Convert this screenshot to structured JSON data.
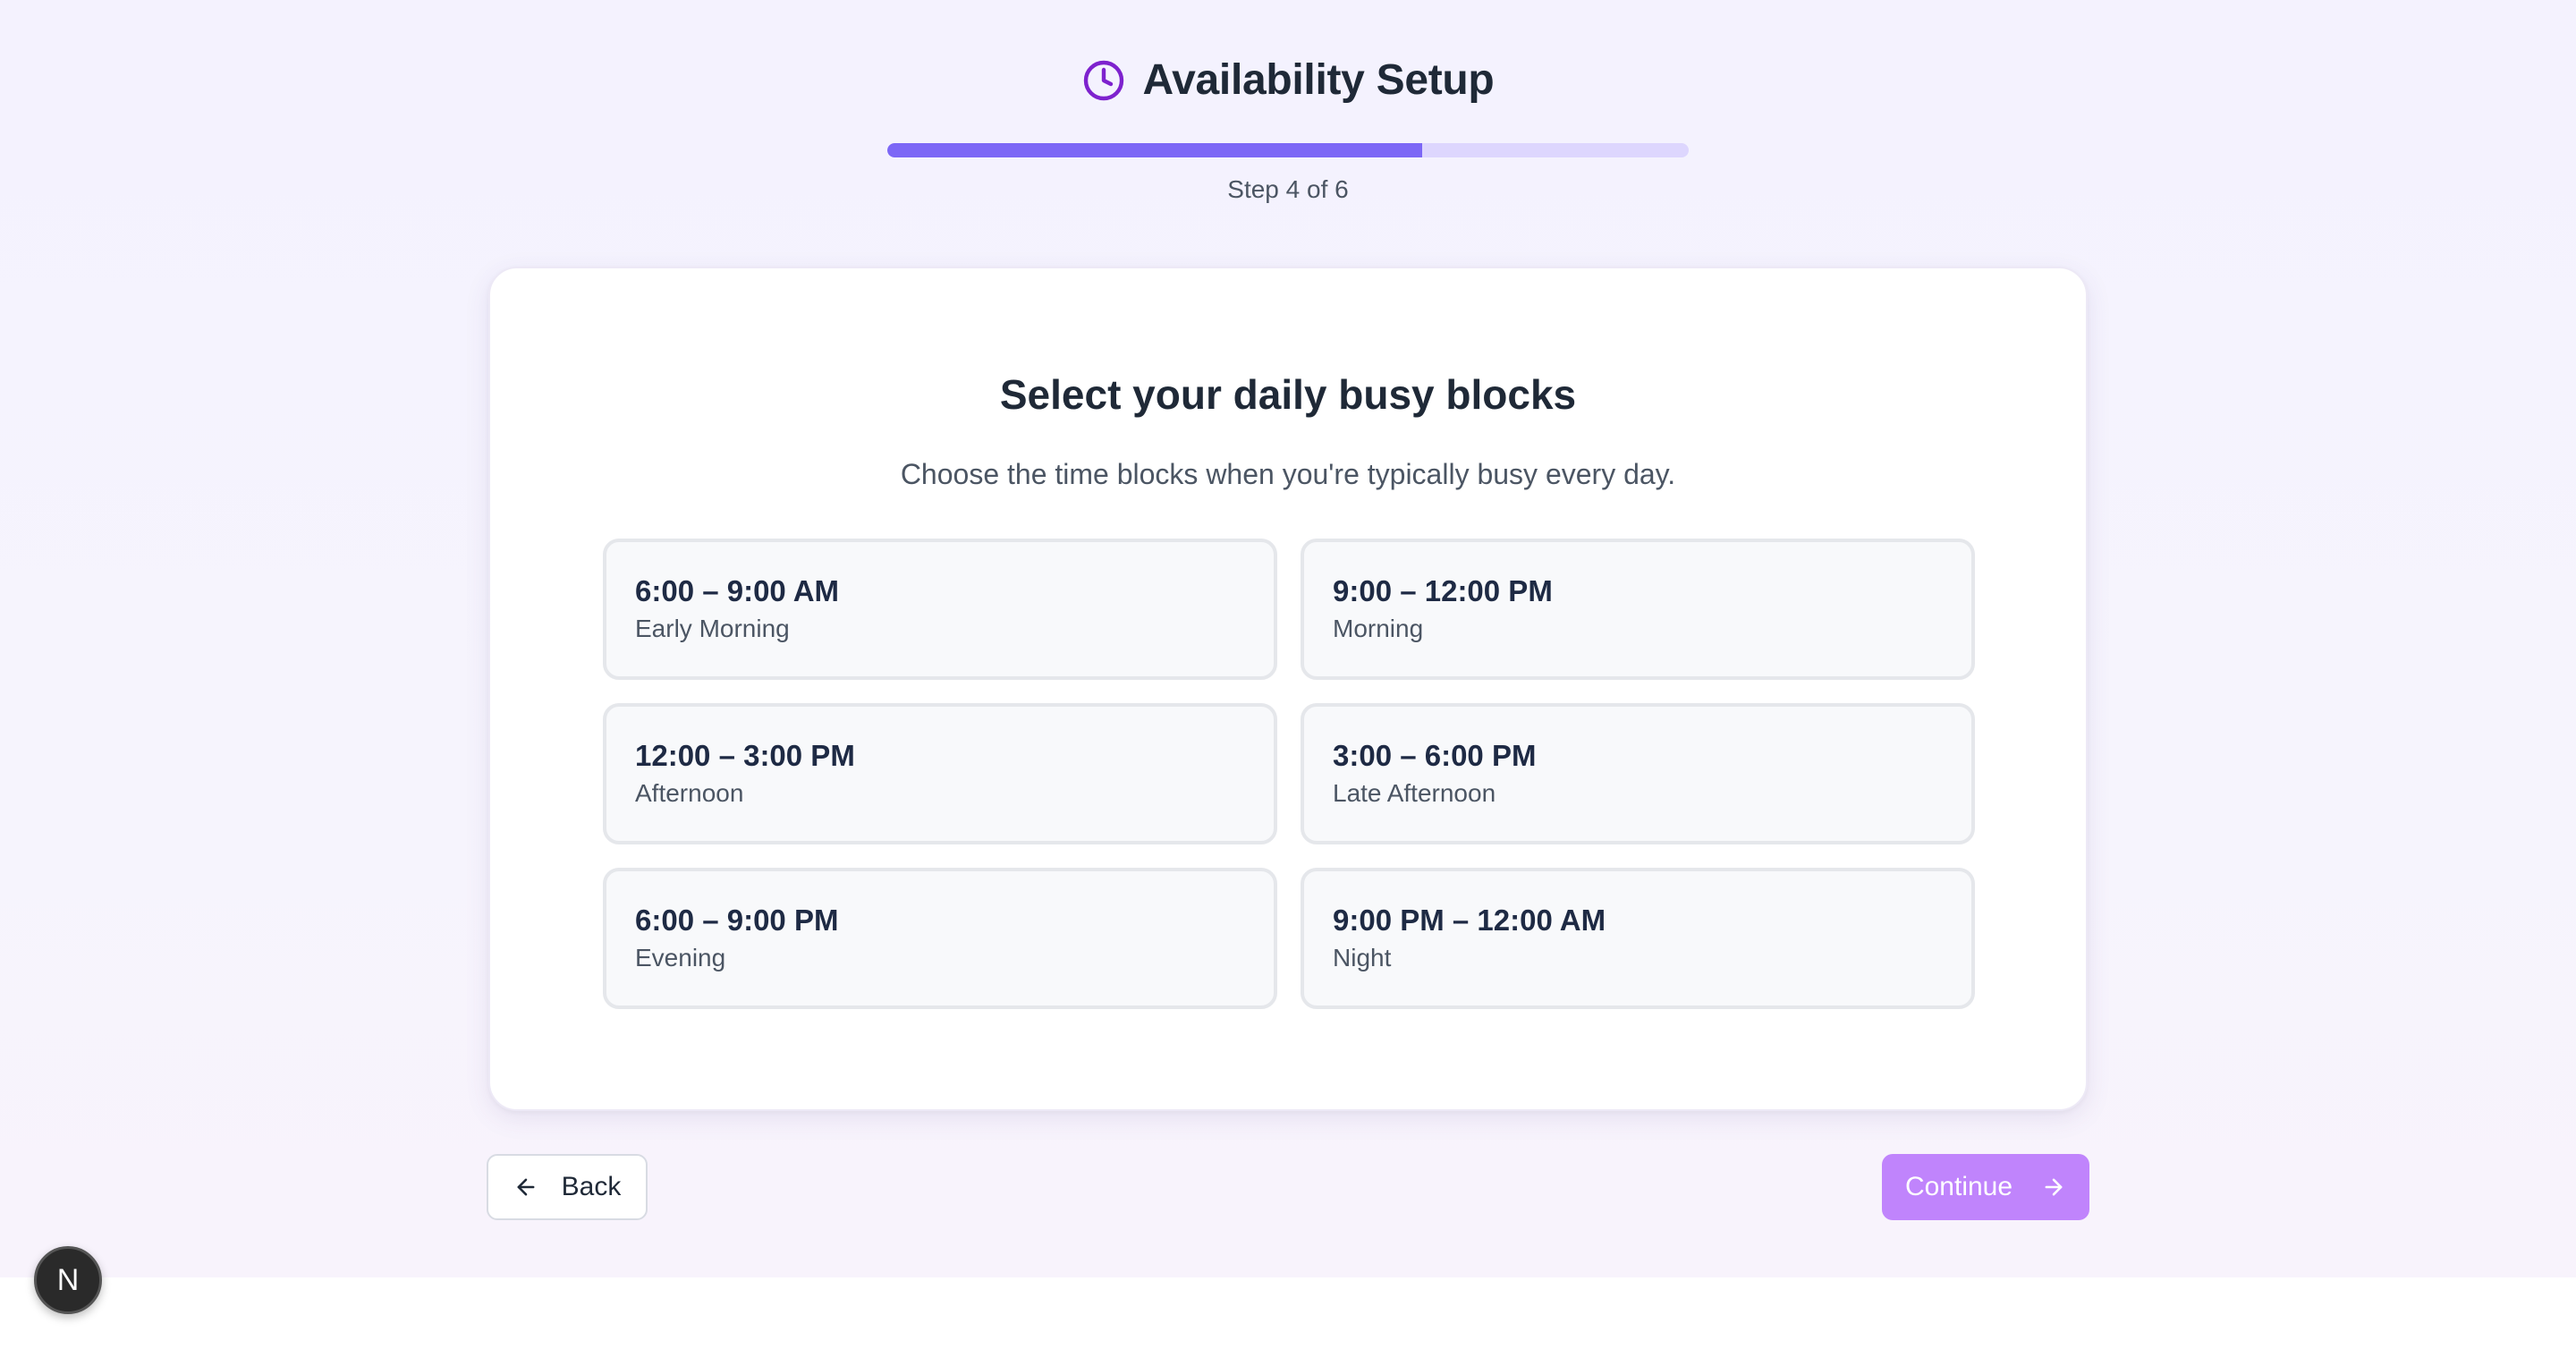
{
  "header": {
    "title": "Availability Setup",
    "title_icon": "clock-icon",
    "step_text": "Step 4 of 6",
    "progress": 0.667,
    "accent_color": "#7c67f6",
    "track_color": "#ddd6fe"
  },
  "card": {
    "title": "Select your daily busy blocks",
    "subtitle": "Choose the time blocks when you're typically busy every day.",
    "blocks": [
      {
        "time": "6:00 – 9:00 AM",
        "label": "Early Morning"
      },
      {
        "time": "9:00 – 12:00 PM",
        "label": "Morning"
      },
      {
        "time": "12:00 – 3:00 PM",
        "label": "Afternoon"
      },
      {
        "time": "3:00 – 6:00 PM",
        "label": "Late Afternoon"
      },
      {
        "time": "6:00 – 9:00 PM",
        "label": "Evening"
      },
      {
        "time": "9:00 PM – 12:00 AM",
        "label": "Night"
      }
    ]
  },
  "footer": {
    "back_label": "Back",
    "back_icon": "arrow-left-icon",
    "continue_label": "Continue",
    "continue_icon": "arrow-right-icon",
    "continue_color": "#c084fc"
  },
  "dev_badge": {
    "letter": "N"
  }
}
